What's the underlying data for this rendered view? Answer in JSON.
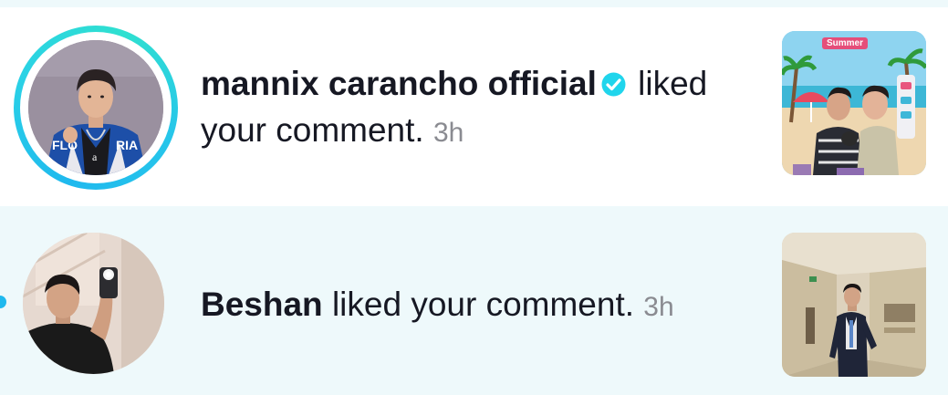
{
  "colors": {
    "accent": "#1fb9ee",
    "highlight_background": "#eef9fb",
    "text": "#161823",
    "timestamp": "#8a8b91"
  },
  "notifications": [
    {
      "username": "mannix carancho official",
      "verified": true,
      "action": "liked your comment.",
      "time": "3h",
      "avatar_ring": true,
      "unread": false,
      "thumbnail_text": "Summer"
    },
    {
      "username": "Beshan",
      "verified": false,
      "action": "liked your comment.",
      "time": "3h",
      "avatar_ring": false,
      "unread": true
    }
  ]
}
